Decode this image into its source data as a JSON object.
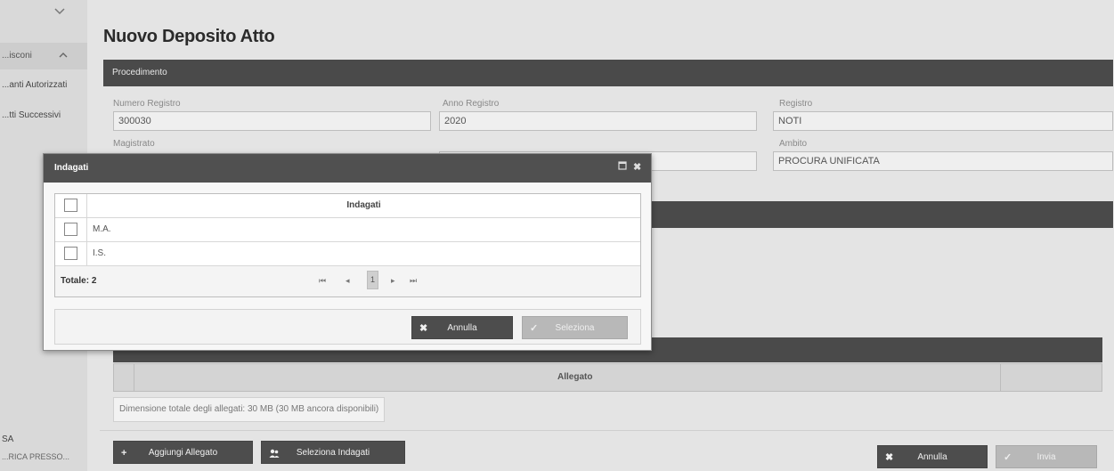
{
  "sidebar": {
    "section_label": "...isconi",
    "items": [
      {
        "label": "...anti Autorizzati"
      },
      {
        "label": "...tti Successivi"
      }
    ],
    "user_name": "SA",
    "user_office": "...RICA PRESSO..."
  },
  "page": {
    "title": "Nuovo Deposito Atto"
  },
  "procedimento": {
    "header": "Procedimento",
    "fields": {
      "numero_registro": {
        "label": "Numero Registro",
        "value": "300030"
      },
      "anno_registro": {
        "label": "Anno Registro",
        "value": "2020"
      },
      "registro": {
        "label": "Registro",
        "value": "NOTI"
      },
      "magistrato": {
        "label": "Magistrato",
        "value": ""
      },
      "ambito": {
        "label": "Ambito",
        "value": "PROCURA UNIFICATA"
      }
    }
  },
  "allegati": {
    "column_label": "Allegato",
    "dimension_note": "Dimensione totale degli allegati: 30 MB (30 MB ancora disponibili)"
  },
  "footer": {
    "aggiungi_allegato": "Aggiungi Allegato",
    "seleziona_indagati": "Seleziona Indagati",
    "annulla": "Annulla",
    "invia": "Invia"
  },
  "modal": {
    "title": "Indagati",
    "grid": {
      "column_header": "Indagati",
      "rows": [
        "M.A.",
        "I.S."
      ],
      "total_label": "Totale: 2",
      "current_page": "1"
    },
    "annulla_label": "Annulla",
    "seleziona_label": "Seleziona"
  },
  "colors": {
    "header_bar": "#4a4a4a",
    "modal_header": "#505050",
    "button_dark": "#4d4d4d",
    "button_disabled": "#b8b8b8"
  }
}
